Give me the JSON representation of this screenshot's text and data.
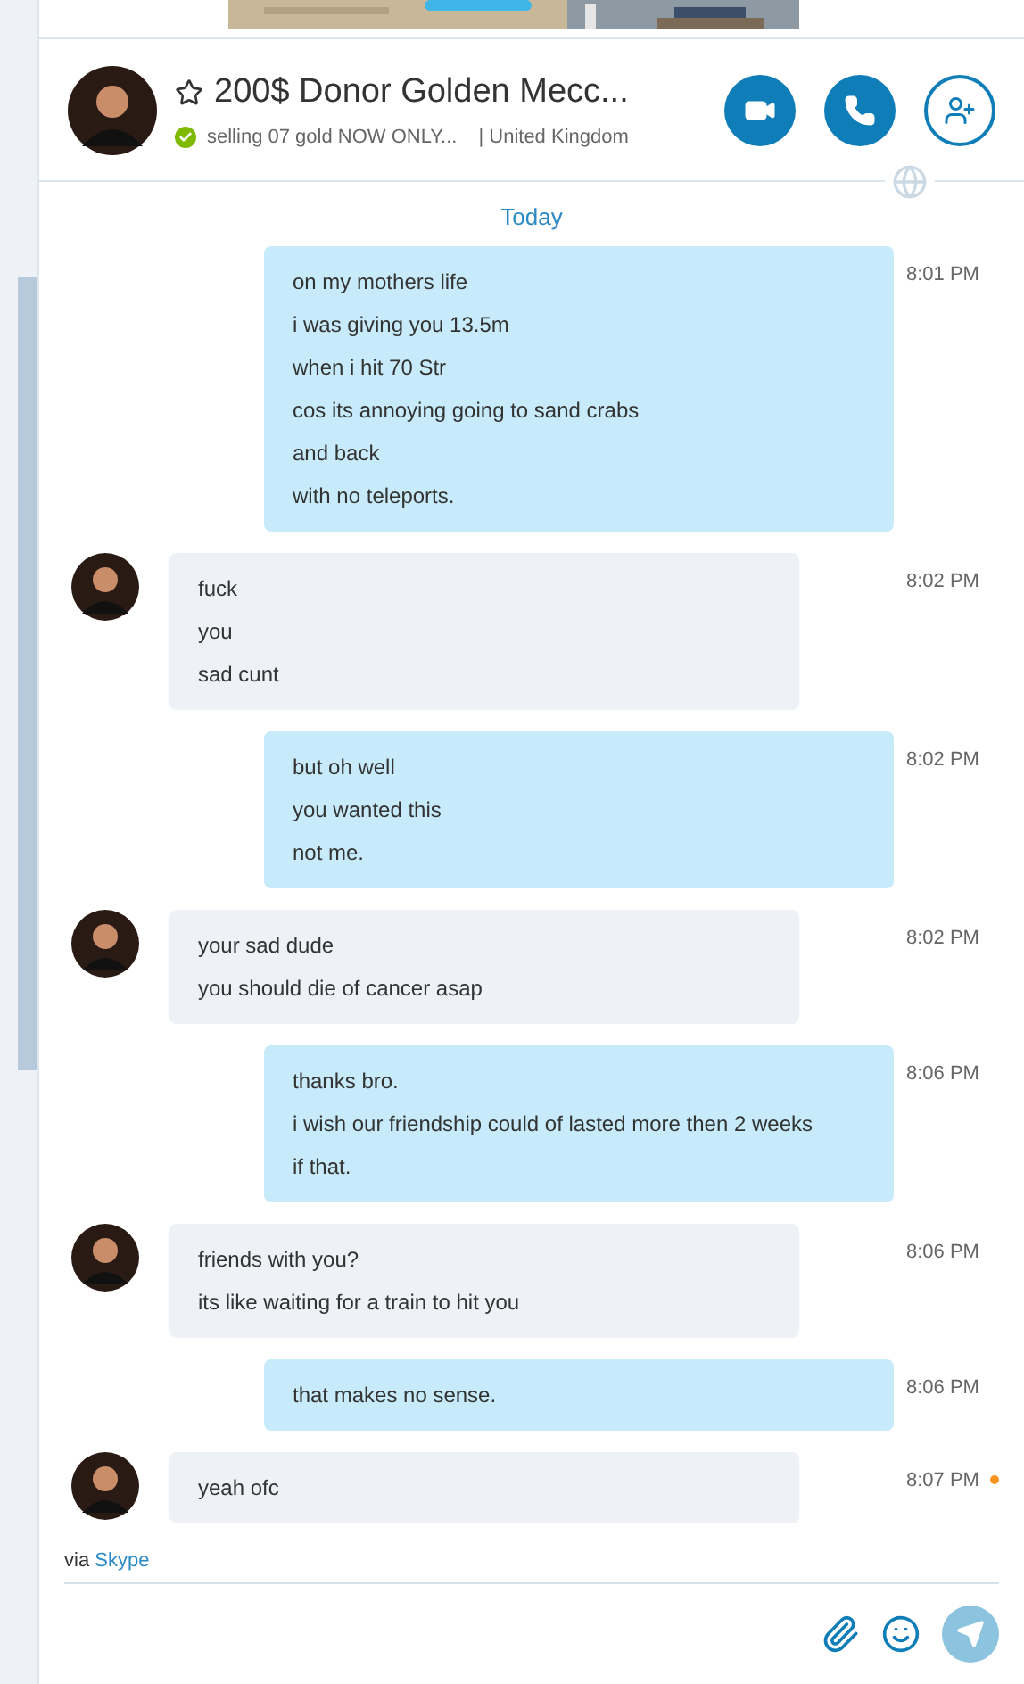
{
  "contact": {
    "name": "200$ Donor Golden Mecc...",
    "favorite": false,
    "online": true,
    "mood": "selling 07 gold NOW ONLY...",
    "location": "| United Kingdom"
  },
  "date_divider": "Today",
  "messages": [
    {
      "kind": "sent",
      "lines": [
        "on my mothers life",
        "i was giving you 13.5m",
        "when i hit 70 Str",
        "cos its annoying going to sand crabs",
        "and back",
        "with no teleports."
      ],
      "time": "8:01 PM",
      "unread": false
    },
    {
      "kind": "received",
      "lines": [
        "fuck",
        "you",
        "sad cunt"
      ],
      "time": "8:02 PM",
      "unread": false
    },
    {
      "kind": "sent",
      "lines": [
        "but oh well",
        "you wanted this",
        "not me."
      ],
      "time": "8:02 PM",
      "unread": false
    },
    {
      "kind": "received",
      "lines": [
        "your sad dude",
        "you should die of cancer asap"
      ],
      "time": "8:02 PM",
      "unread": false
    },
    {
      "kind": "sent",
      "lines": [
        "thanks bro.",
        "i wish our friendship could of lasted more then 2 weeks",
        "if that."
      ],
      "time": "8:06 PM",
      "unread": false
    },
    {
      "kind": "received",
      "lines": [
        "friends with you?",
        "its like waiting for a train to hit you"
      ],
      "time": "8:06 PM",
      "unread": false
    },
    {
      "kind": "sent",
      "lines": [
        "that makes no sense."
      ],
      "time": "8:06 PM",
      "unread": false
    },
    {
      "kind": "received",
      "lines": [
        "yeah ofc"
      ],
      "time": "8:07 PM",
      "unread": true
    }
  ],
  "via": {
    "prefix": "via",
    "link": "Skype"
  }
}
